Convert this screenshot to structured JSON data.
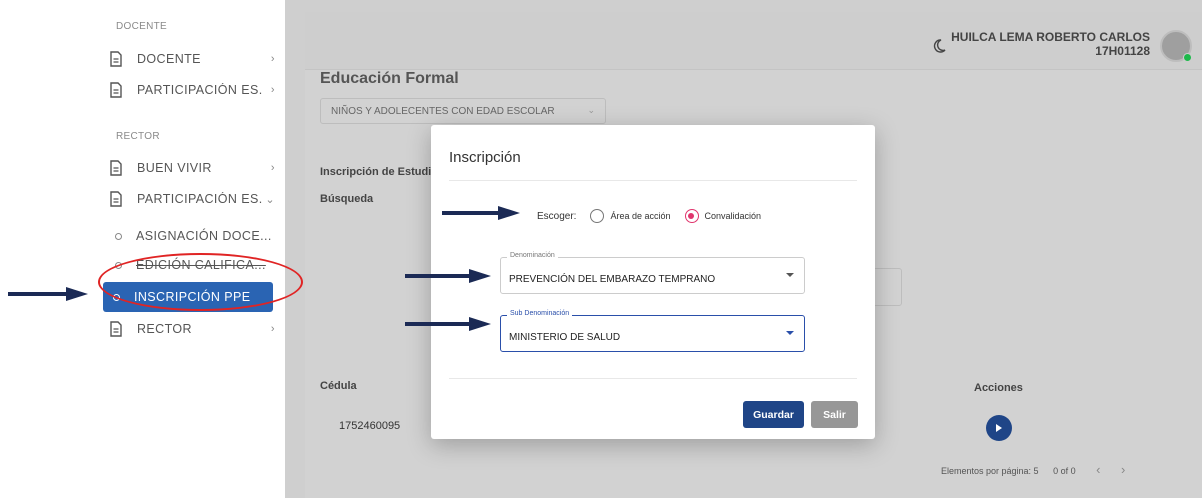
{
  "sidebar": {
    "sections": [
      {
        "title": "DOCENTE"
      },
      {
        "title": "RECTOR"
      }
    ],
    "docente_items": [
      {
        "label": "DOCENTE",
        "icon": "document-icon"
      },
      {
        "label": "PARTICIPACIÓN ES..."
      }
    ],
    "rector_items": [
      {
        "label": "BUEN VIVIR"
      },
      {
        "label": "PARTICIPACIÓN ES..."
      }
    ],
    "sub_items": [
      {
        "label": "ASIGNACIÓN DOCE..."
      },
      {
        "label": "EDICIÓN CALIFICA..."
      },
      {
        "label": "INSCRIPCIÓN PPE"
      }
    ],
    "last_item": {
      "label": "RECTOR"
    },
    "active_color": "#2a64b3"
  },
  "header": {
    "user_name": "HUILCA LEMA ROBERTO CARLOS",
    "user_code": "17H01128"
  },
  "main": {
    "title": "Educación Formal",
    "category_select": "NIÑOS Y ADOLECENTES CON EDAD ESCOLAR",
    "section_title": "Inscripción de Estudi",
    "search_label": "Búsqueda",
    "table": {
      "col_cedula": "Cédula",
      "col_acciones": "Acciones",
      "rows": [
        {
          "cedula": "1752460095"
        }
      ]
    },
    "pager": {
      "items_per_page_label": "Elementos por página: 5",
      "range": "0 of 0"
    }
  },
  "modal": {
    "title": "Inscripción",
    "choose_label": "Escoger:",
    "options": [
      {
        "label": "Área de acción",
        "selected": false
      },
      {
        "label": "Convalidación",
        "selected": true
      }
    ],
    "denominacion": {
      "legend": "Denominación",
      "value": "PREVENCIÓN DEL EMBARAZO TEMPRANO"
    },
    "sub_denominacion": {
      "legend": "Sub Denominación",
      "value": "MINISTERIO DE SALUD"
    },
    "save_label": "Guardar",
    "exit_label": "Salir",
    "accent": "#e0356d",
    "primary": "#1f4587"
  }
}
